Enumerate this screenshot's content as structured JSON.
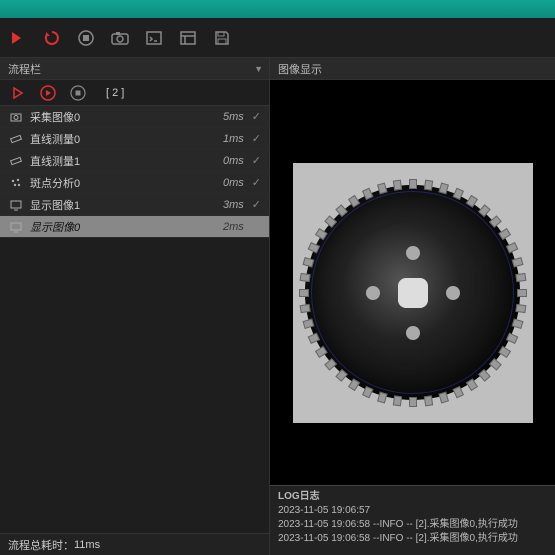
{
  "titlebar": {},
  "toolbar": {
    "icons": [
      "forward-arrow",
      "refresh",
      "stop",
      "camera",
      "terminal",
      "layout",
      "save"
    ]
  },
  "left": {
    "header": "流程栏",
    "counter": "[ 2 ]",
    "steps": [
      {
        "icon": "camera",
        "name": "采集图像0",
        "time": "5ms",
        "ok": true,
        "sel": false
      },
      {
        "icon": "ruler",
        "name": "直线测量0",
        "time": "1ms",
        "ok": true,
        "sel": false
      },
      {
        "icon": "ruler",
        "name": "直线测量1",
        "time": "0ms",
        "ok": true,
        "sel": false
      },
      {
        "icon": "dots",
        "name": "斑点分析0",
        "time": "0ms",
        "ok": true,
        "sel": false
      },
      {
        "icon": "display",
        "name": "显示图像1",
        "time": "3ms",
        "ok": true,
        "sel": false
      },
      {
        "icon": "display",
        "name": "显示图像0",
        "time": "2ms",
        "ok": true,
        "sel": true
      }
    ],
    "footer_label": "流程总耗时：",
    "footer_value": "11ms"
  },
  "right": {
    "header": "图像显示",
    "log_header": "LOG日志",
    "log_lines": [
      "2023-11-05 19:06:57",
      "2023-11-05 19:06:58 --INFO -- [2].采集图像0,执行成功",
      "2023-11-05 19:06:58 --INFO -- [2].采集图像0,执行成功"
    ]
  }
}
